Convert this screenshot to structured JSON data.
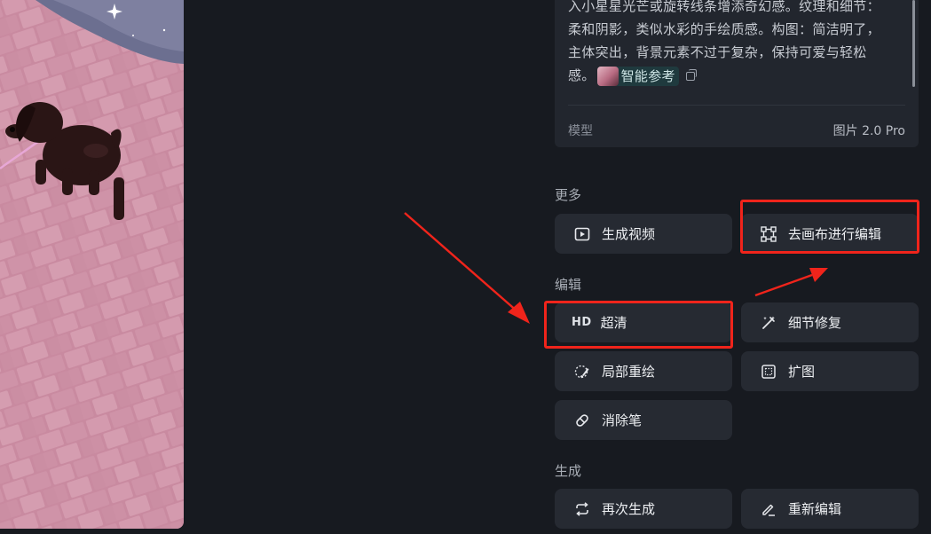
{
  "prompt": {
    "lines": [
      "入小星星光芒或旋转线条增添奇幻感。纹理和细节：",
      "柔和阴影，类似水彩的手绘质感。构图：简洁明了，",
      "主体突出，背景元素不过于复杂，保持可爱与轻松",
      "感。"
    ],
    "reference_label": "智能参考"
  },
  "model": {
    "label": "模型",
    "value": "图片 2.0 Pro"
  },
  "sections": {
    "more": {
      "title": "更多",
      "generate_video": "生成视频",
      "go_canvas_edit": "去画布进行编辑"
    },
    "edit": {
      "title": "编辑",
      "hd_badge": "HD",
      "upscale": "超清",
      "detail_fix": "细节修复",
      "inpaint": "局部重绘",
      "outpaint": "扩图",
      "eraser": "消除笔"
    },
    "generate": {
      "title": "生成",
      "regenerate": "再次生成",
      "re_edit": "重新编辑"
    }
  },
  "colors": {
    "background": "#171a20",
    "card": "#22262e",
    "button": "#262a32",
    "highlight": "#f0241b"
  }
}
